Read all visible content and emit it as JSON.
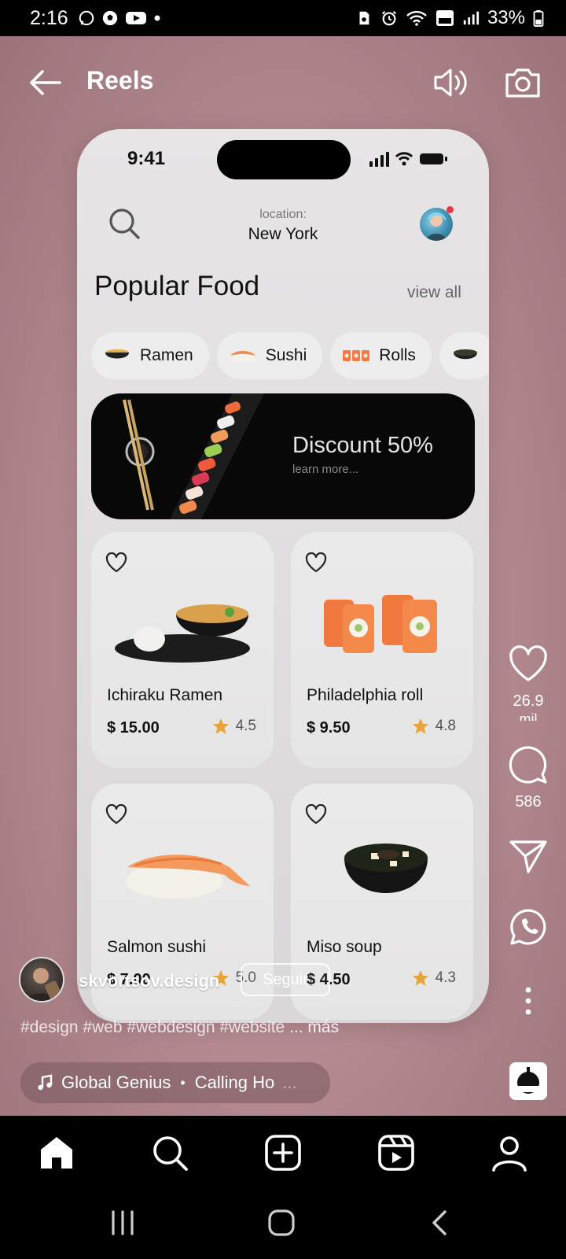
{
  "status_bar": {
    "time": "2:16",
    "battery": "33%"
  },
  "reel_header": {
    "title": "Reels"
  },
  "phone": {
    "time": "9:41",
    "location_label": "location:",
    "location_city": "New York",
    "heading": "Popular Food",
    "view_all": "view all",
    "chips": [
      {
        "label": "Ramen"
      },
      {
        "label": "Sushi"
      },
      {
        "label": "Rolls"
      }
    ],
    "banner": {
      "title": "Discount 50%",
      "subtitle": "learn more..."
    },
    "cards": [
      {
        "name": "Ichiraku Ramen",
        "price": "$ 15.00",
        "rating": "4.5"
      },
      {
        "name": "Philadelphia roll",
        "price": "$ 9.50",
        "rating": "4.8"
      },
      {
        "name": "Salmon sushi",
        "price": "$ 7.00",
        "rating": "5.0"
      },
      {
        "name": "Miso soup",
        "price": "$ 4.50",
        "rating": "4.3"
      }
    ]
  },
  "rail": {
    "likes": "26.9",
    "likes_suffix": "mil",
    "comments": "586"
  },
  "caption": {
    "author": "skvortsov.design",
    "follow": "Seguir",
    "hashtags": "#design #web #webdesign #website",
    "more": "... más",
    "music_artist": "Global Genius",
    "music_title": "Calling Ho",
    "music_fade": "..."
  },
  "colors": {
    "accent_star": "#e8a33a",
    "notification_dot": "#e63946"
  }
}
